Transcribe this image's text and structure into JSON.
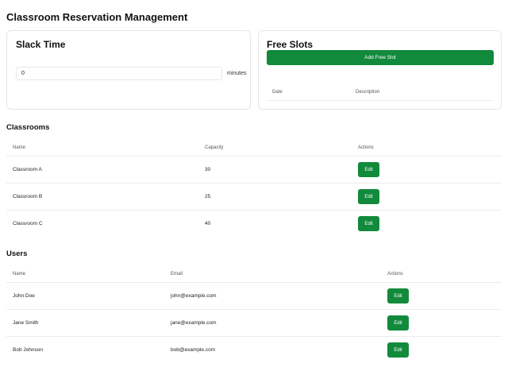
{
  "page_title": "Classroom Reservation Management",
  "slack": {
    "title": "Slack Time",
    "value": "0",
    "unit": "minutes"
  },
  "free_slots": {
    "title": "Free Slots",
    "add_label": "Add Free Slot",
    "columns": [
      "Date",
      "Description"
    ]
  },
  "classrooms": {
    "title": "Classrooms",
    "columns": [
      "Name",
      "Capacity",
      "Actions"
    ],
    "rows": [
      {
        "name": "Classroom A",
        "capacity": "30",
        "action": "Edit"
      },
      {
        "name": "Classroom B",
        "capacity": "25",
        "action": "Edit"
      },
      {
        "name": "Classroom C",
        "capacity": "40",
        "action": "Edit"
      }
    ]
  },
  "users": {
    "title": "Users",
    "columns": [
      "Name",
      "Email",
      "Actions"
    ],
    "rows": [
      {
        "name": "John Doe",
        "email": "john@example.com",
        "action": "Edit"
      },
      {
        "name": "Jane Smith",
        "email": "jane@example.com",
        "action": "Edit"
      },
      {
        "name": "Bob Johnson",
        "email": "bob@example.com",
        "action": "Edit"
      }
    ]
  },
  "colors": {
    "accent": "#128a3c",
    "border": "#e5e5e5"
  }
}
